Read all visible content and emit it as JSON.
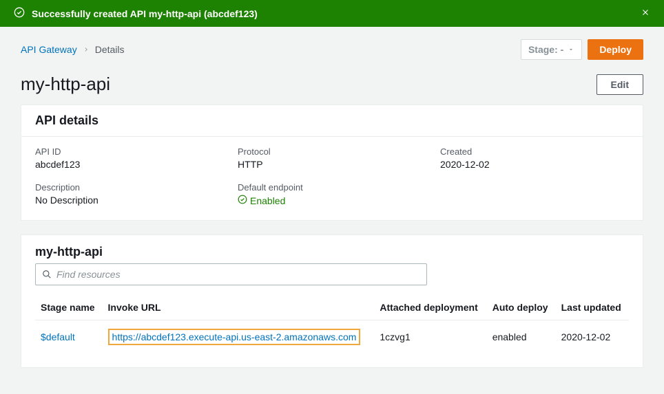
{
  "banner": {
    "message": "Successfully created API my-http-api (abcdef123)"
  },
  "breadcrumb": {
    "root": "API Gateway",
    "current": "Details"
  },
  "actions": {
    "stage_label": "Stage: -",
    "deploy": "Deploy",
    "edit": "Edit"
  },
  "page": {
    "title": "my-http-api"
  },
  "details": {
    "heading": "API details",
    "api_id_label": "API ID",
    "api_id": "abcdef123",
    "protocol_label": "Protocol",
    "protocol": "HTTP",
    "created_label": "Created",
    "created": "2020-12-02",
    "description_label": "Description",
    "description": "No Description",
    "endpoint_label": "Default endpoint",
    "endpoint_status": "Enabled"
  },
  "stages": {
    "heading": "my-http-api",
    "search_placeholder": "Find resources",
    "cols": {
      "stage": "Stage name",
      "url": "Invoke URL",
      "deployment": "Attached deployment",
      "auto": "Auto deploy",
      "updated": "Last updated"
    },
    "row": {
      "stage": "$default",
      "url": "https://abcdef123.execute-api.us-east-2.amazonaws.com",
      "deployment": "1czvg1",
      "auto": "enabled",
      "updated": "2020-12-02"
    }
  }
}
